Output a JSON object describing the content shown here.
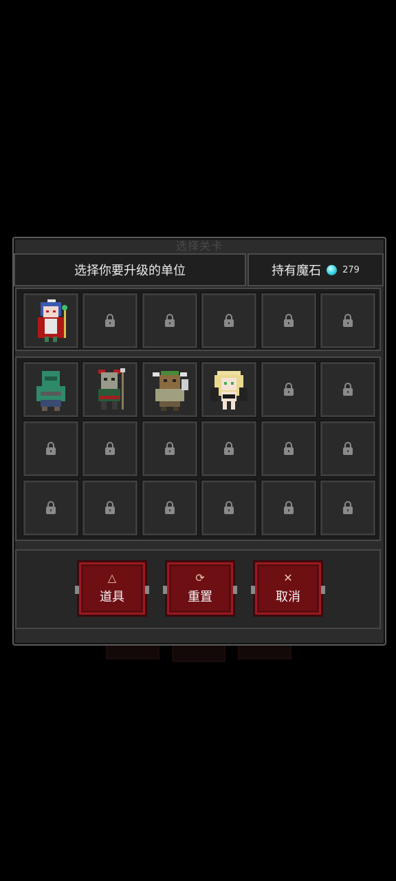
{
  "panel": {
    "caption": "选择关卡"
  },
  "header": {
    "title": "选择你要升级的单位",
    "stone_label": "持有魔石",
    "stone_count": "279"
  },
  "units": [
    {
      "id": "mage_girl",
      "name": "魔法少女"
    },
    {
      "id": "zombie",
      "name": "僵尸"
    },
    {
      "id": "orc_spear",
      "name": "兽人"
    },
    {
      "id": "minotaur",
      "name": "牛头人"
    },
    {
      "id": "elf",
      "name": "精灵"
    }
  ],
  "buttons": {
    "items": "道具",
    "reset": "重置",
    "cancel": "取消"
  },
  "icons": {
    "items": "flask-icon",
    "reset": "refresh-icon",
    "cancel": "close-icon",
    "stone": "gem-icon",
    "lock": "lock-icon"
  },
  "colors": {
    "button": "#6e0f14",
    "gem": "#33d0e0",
    "panel": "#2c2c2c"
  }
}
